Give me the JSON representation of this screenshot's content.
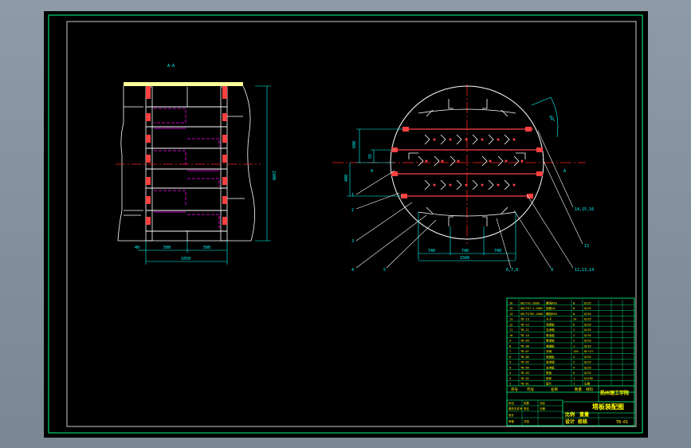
{
  "colors": {
    "background": "#000000",
    "frame": "#00ff80",
    "outline": "#ffffff",
    "centerline": "#ff2020",
    "dimension": "#00ffff",
    "hidden": "#ff00ff",
    "leader": "#ffffff",
    "weld": "#ff4040",
    "title_text": "#ffff00",
    "background_chrome": "#8e9aa6"
  },
  "elevation_view": {
    "section_mark": "A-A",
    "dims": {
      "height": "2300",
      "left_gap": "40",
      "half_left": "500",
      "half_right": "500",
      "overall": "1050"
    }
  },
  "plan_view": {
    "section_marks": [
      "A",
      "A"
    ],
    "dims": {
      "v1": "600",
      "v2": "55",
      "v3": "400",
      "seg1": "740",
      "seg2": "740",
      "seg3": "740",
      "total": "1560",
      "angle": "60°"
    },
    "leaders_left": [
      "1",
      "2",
      "3",
      "4",
      "5"
    ],
    "leaders_right": [
      "14,15,16",
      "13",
      "12,13,14",
      "6,7,8",
      "9"
    ]
  },
  "title_block": {
    "school": "扬州理工学院",
    "drawing_title": "塔板装配图",
    "drawing_no": "TB-01",
    "parts_header": [
      "序号",
      "代号",
      "名称",
      "数量",
      "材料"
    ],
    "parts_rows": [
      [
        "16",
        "GB/T41-2000",
        "螺母M10",
        "8",
        "Q235"
      ],
      [
        "15",
        "GB/T97.1-2002",
        "垫圈10",
        "8",
        "Q235"
      ],
      [
        "14",
        "GB/T5782-2000",
        "螺栓M10",
        "8",
        "Q235"
      ],
      [
        "13",
        "TB-13",
        "卡子",
        "24",
        "Q235"
      ],
      [
        "12",
        "TB-12",
        "连接板",
        "6",
        "Q235"
      ],
      [
        "11",
        "TB-11",
        "支承圈",
        "1",
        "Q235"
      ],
      [
        "10",
        "TB-10",
        "受液盘",
        "2",
        "Q235"
      ],
      [
        "9",
        "TB-09",
        "降液板",
        "2",
        "Q235"
      ],
      [
        "8",
        "TB-08",
        "通道板",
        "1",
        "Q235"
      ],
      [
        "7",
        "TB-07",
        "浮阀",
        "120",
        "0Cr13"
      ],
      [
        "6",
        "TB-06",
        "塔盘板",
        "4",
        "Q235"
      ],
      [
        "5",
        "TB-05",
        "溢流堰",
        "2",
        "Q235"
      ],
      [
        "4",
        "TB-04",
        "支持板",
        "4",
        "Q235"
      ],
      [
        "3",
        "TB-03",
        "筋板",
        "6",
        "Q235"
      ],
      [
        "2",
        "TB-02",
        "塔体",
        "1",
        "Q345R"
      ],
      [
        "1",
        "TB-01",
        "垫片",
        "1",
        "石棉"
      ]
    ],
    "stamp_left": [
      "设计",
      "校核",
      "审核"
    ],
    "stamp_right": [
      "比例",
      "重量",
      "共张"
    ],
    "mini_labels": [
      "标记",
      "处数",
      "分区",
      "更改文件号",
      "签名",
      "日期"
    ]
  }
}
